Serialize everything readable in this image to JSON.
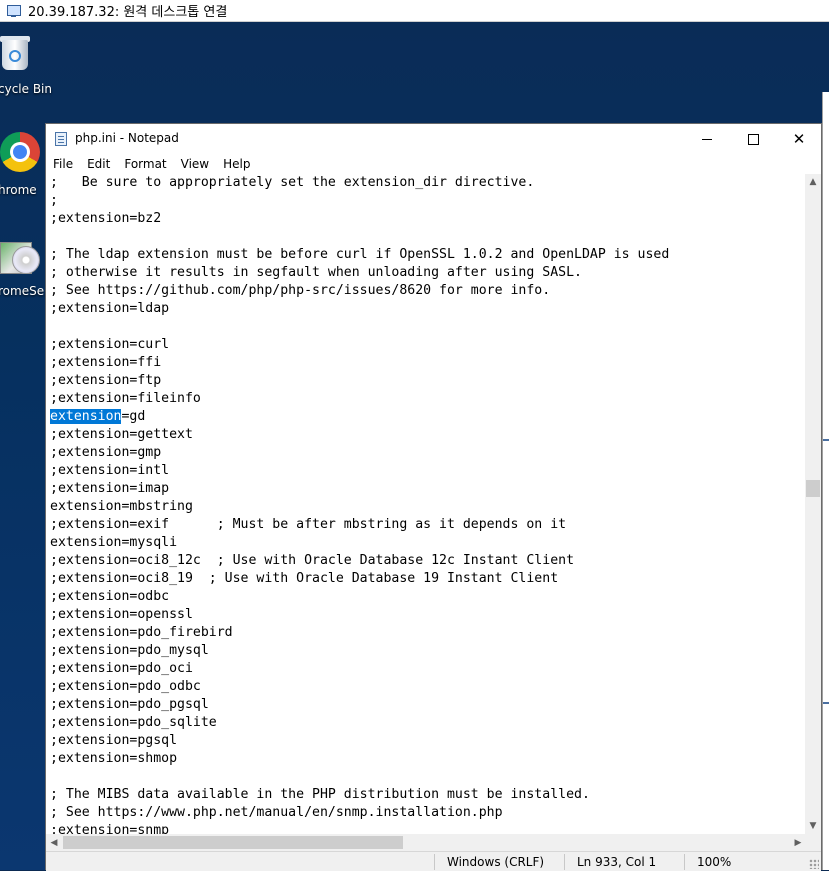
{
  "rdp": {
    "title": "20.39.187.32: 원격 데스크톱 연결"
  },
  "desktop": {
    "icons": [
      {
        "label": "cycle Bin"
      },
      {
        "label": "hrome"
      },
      {
        "label": "romeSe..."
      }
    ]
  },
  "notepad": {
    "title": "php.ini - Notepad",
    "controls": {
      "minimize": "",
      "maximize": "",
      "close": "✕"
    },
    "menu": [
      "File",
      "Edit",
      "Format",
      "View",
      "Help"
    ],
    "lines_before": ";   Be sure to appropriately set the extension_dir directive.\n;\n;extension=bz2\n\n; The ldap extension must be before curl if OpenSSL 1.0.2 and OpenLDAP is used\n; otherwise it results in segfault when unloading after using SASL.\n; See https://github.com/php/php-src/issues/8620 for more info.\n;extension=ldap\n\n;extension=curl\n;extension=ffi\n;extension=ftp\n;extension=fileinfo\n",
    "selected_text": "extension",
    "after_selection": "=gd",
    "lines_after": "\n;extension=gettext\n;extension=gmp\n;extension=intl\n;extension=imap\nextension=mbstring\n;extension=exif      ; Must be after mbstring as it depends on it\nextension=mysqli\n;extension=oci8_12c  ; Use with Oracle Database 12c Instant Client\n;extension=oci8_19  ; Use with Oracle Database 19 Instant Client\n;extension=odbc\n;extension=openssl\n;extension=pdo_firebird\n;extension=pdo_mysql\n;extension=pdo_oci\n;extension=pdo_odbc\n;extension=pdo_pgsql\n;extension=pdo_sqlite\n;extension=pgsql\n;extension=shmop\n\n; The MIBS data available in the PHP distribution must be installed.\n; See https://www.php.net/manual/en/snmp.installation.php\n;extension=snmp",
    "status": {
      "encoding": "Windows (CRLF)",
      "position": "Ln 933, Col 1",
      "zoom": "100%"
    },
    "scroll": {
      "up": "▲",
      "down": "▼",
      "left": "◀",
      "right": "▶"
    }
  }
}
